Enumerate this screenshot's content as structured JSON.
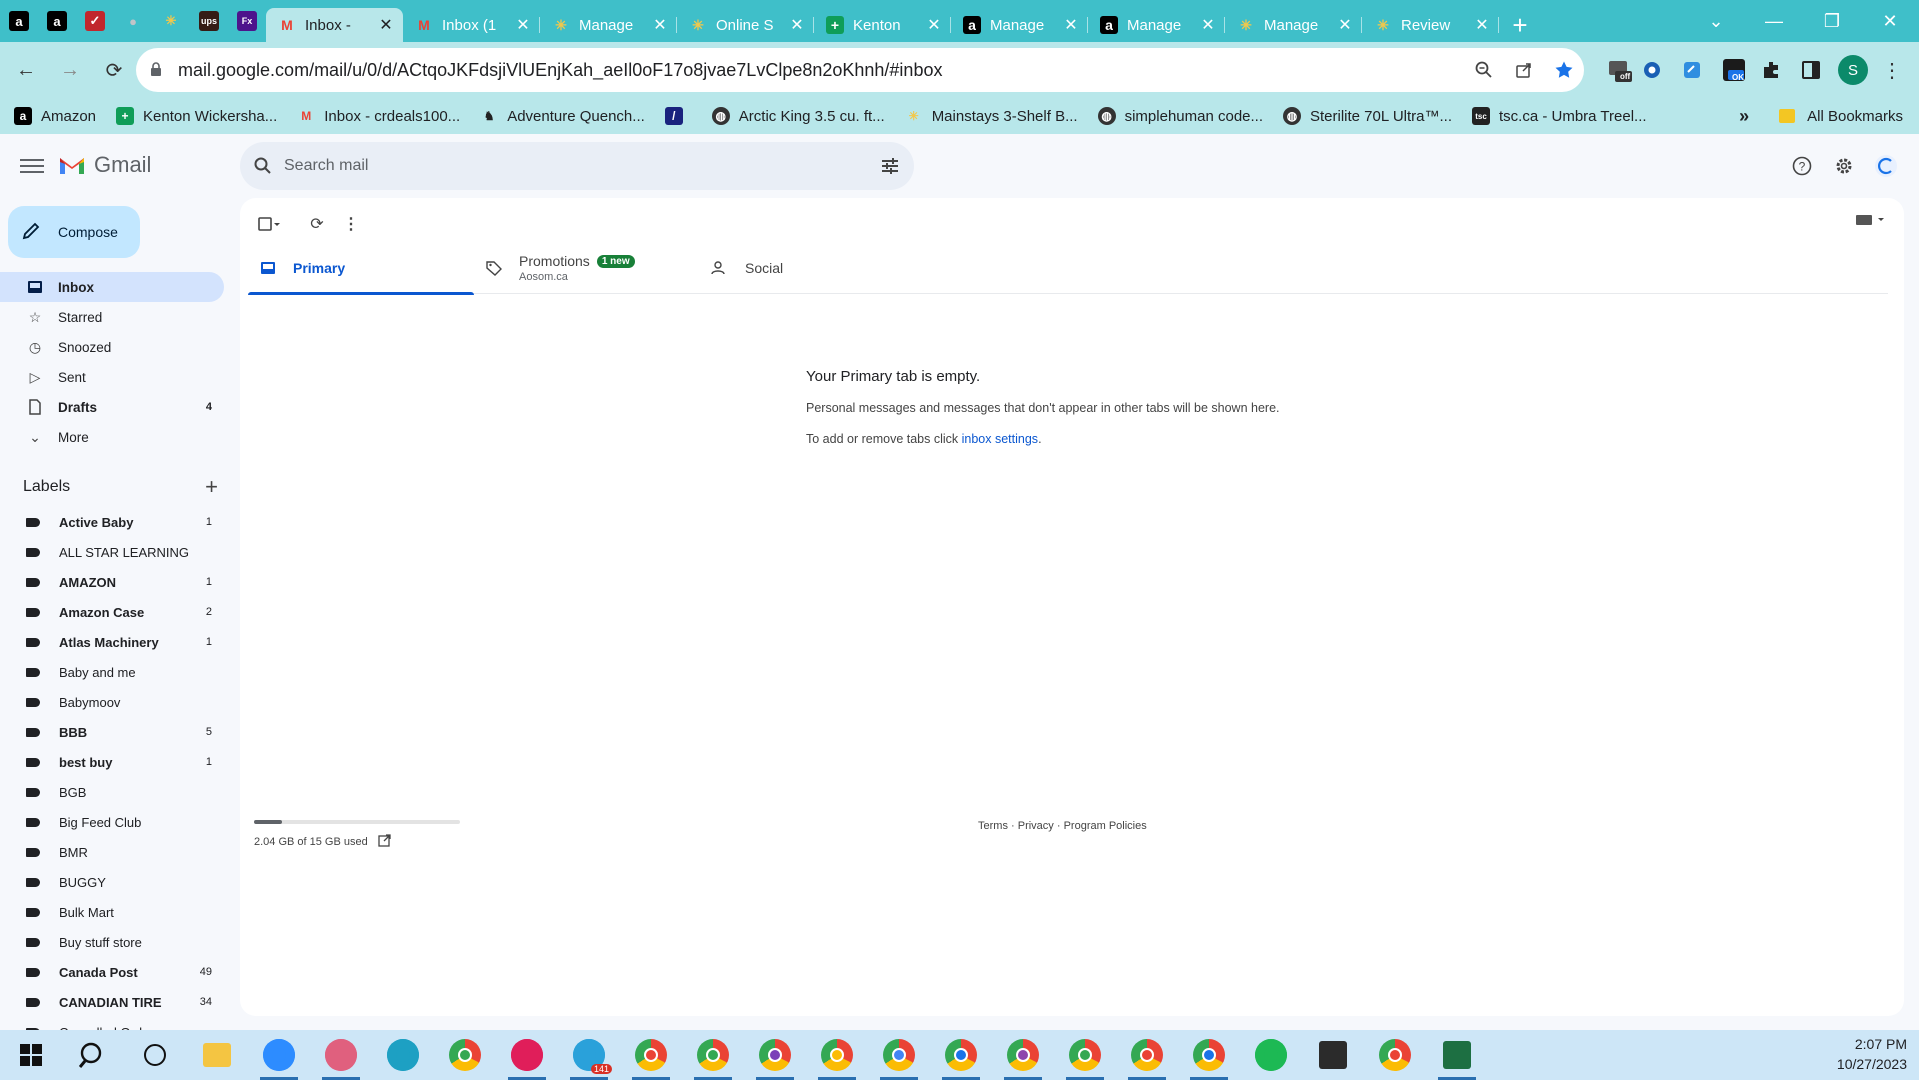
{
  "browser": {
    "pinned_tabs": [
      {
        "icon": "amazon-icon",
        "glyph": "a",
        "color": "#000000"
      },
      {
        "icon": "amazon-icon",
        "glyph": "a",
        "color": "#000000"
      },
      {
        "icon": "brand-checkmark-icon",
        "glyph": "✓",
        "color": "#c1272d"
      },
      {
        "icon": "globe-icon",
        "glyph": "●",
        "color": "#9aa0a6"
      },
      {
        "icon": "walmart-spark-icon",
        "glyph": "✳",
        "color": "#3fbfc9"
      },
      {
        "icon": "ups-icon",
        "glyph": "ups",
        "color": "#351c15"
      },
      {
        "icon": "fedex-icon",
        "glyph": "Fx",
        "color": "#4d148c"
      }
    ],
    "tabs": [
      {
        "title": "Inbox -",
        "icon": "gmail-icon",
        "active": true
      },
      {
        "title": "Inbox (1",
        "icon": "gmail-icon",
        "active": false
      },
      {
        "title": "Manage",
        "icon": "walmart-spark-icon",
        "active": false
      },
      {
        "title": "Online S",
        "icon": "walmart-spark-icon",
        "active": false
      },
      {
        "title": "Kenton",
        "icon": "sheets-icon",
        "active": false
      },
      {
        "title": "Manage",
        "icon": "amazon-icon",
        "active": false
      },
      {
        "title": "Manage",
        "icon": "amazon-icon",
        "active": false
      },
      {
        "title": "Manage",
        "icon": "walmart-spark-icon",
        "active": false
      },
      {
        "title": "Review",
        "icon": "walmart-spark-icon",
        "active": false
      }
    ],
    "url": "mail.google.com/mail/u/0/d/ACtqoJKFdsjiVlUEnjKah_aeIl0oF17o8jvae7LvClpe8n2oKhnh/#inbox",
    "profile_initial": "S",
    "ext_off_badge": "off",
    "ext_ok_badge": "OK",
    "bookmarks": [
      {
        "label": "Amazon",
        "icon": "amazon-icon"
      },
      {
        "label": "Kenton Wickersha...",
        "icon": "sheets-icon"
      },
      {
        "label": "Inbox - crdeals100...",
        "icon": "gmail-icon"
      },
      {
        "label": "Adventure Quench...",
        "icon": "horse-icon"
      },
      {
        "label": "",
        "icon": "dark-app-icon"
      },
      {
        "label": "Arctic King 3.5 cu. ft...",
        "icon": "globe-icon"
      },
      {
        "label": "Mainstays 3-Shelf B...",
        "icon": "walmart-spark-icon"
      },
      {
        "label": "simplehuman code...",
        "icon": "globe-icon"
      },
      {
        "label": "Sterilite 70L Ultra™...",
        "icon": "globe-icon"
      },
      {
        "label": "tsc.ca - Umbra Treel...",
        "icon": "tsc-icon"
      }
    ],
    "bookmarks_more": "»",
    "all_bookmarks": "All Bookmarks"
  },
  "gmail": {
    "app_name": "Gmail",
    "search_placeholder": "Search mail",
    "compose": "Compose",
    "nav": [
      {
        "label": "Inbox",
        "icon": "inbox-icon",
        "count": "",
        "active": true,
        "bold": true
      },
      {
        "label": "Starred",
        "icon": "star-icon",
        "count": "",
        "active": false,
        "bold": false
      },
      {
        "label": "Snoozed",
        "icon": "clock-icon",
        "count": "",
        "active": false,
        "bold": false
      },
      {
        "label": "Sent",
        "icon": "send-icon",
        "count": "",
        "active": false,
        "bold": false
      },
      {
        "label": "Drafts",
        "icon": "draft-icon",
        "count": "4",
        "active": false,
        "bold": true
      },
      {
        "label": "More",
        "icon": "chevron-down-icon",
        "count": "",
        "active": false,
        "bold": false
      }
    ],
    "labels_title": "Labels",
    "labels": [
      {
        "name": "Active Baby",
        "count": "1",
        "bold": true
      },
      {
        "name": "ALL STAR LEARNING",
        "count": "",
        "bold": false
      },
      {
        "name": "AMAZON",
        "count": "1",
        "bold": true
      },
      {
        "name": "Amazon Case",
        "count": "2",
        "bold": true
      },
      {
        "name": "Atlas Machinery",
        "count": "1",
        "bold": true
      },
      {
        "name": "Baby and me",
        "count": "",
        "bold": false
      },
      {
        "name": "Babymoov",
        "count": "",
        "bold": false
      },
      {
        "name": "BBB",
        "count": "5",
        "bold": true
      },
      {
        "name": "best buy",
        "count": "1",
        "bold": true
      },
      {
        "name": "BGB",
        "count": "",
        "bold": false
      },
      {
        "name": "Big Feed Club",
        "count": "",
        "bold": false
      },
      {
        "name": "BMR",
        "count": "",
        "bold": false
      },
      {
        "name": "BUGGY",
        "count": "",
        "bold": false
      },
      {
        "name": "Bulk Mart",
        "count": "",
        "bold": false
      },
      {
        "name": "Buy stuff store",
        "count": "",
        "bold": false
      },
      {
        "name": "Canada Post",
        "count": "49",
        "bold": true
      },
      {
        "name": "CANADIAN TIRE",
        "count": "34",
        "bold": true
      },
      {
        "name": "Cancelled Order",
        "count": "",
        "bold": false
      }
    ],
    "inbox_tabs": [
      {
        "label": "Primary",
        "icon": "inbox-tab-icon",
        "sub": "",
        "badge": "",
        "active": true
      },
      {
        "label": "Promotions",
        "icon": "tag-icon",
        "sub": "Aosom.ca",
        "badge": "1 new",
        "active": false
      },
      {
        "label": "Social",
        "icon": "people-icon",
        "sub": "",
        "badge": "",
        "active": false
      }
    ],
    "empty": {
      "title": "Your Primary tab is empty.",
      "line1": "Personal messages and messages that don't appear in other tabs will be shown here.",
      "line2_prefix": "To add or remove tabs click ",
      "line2_link": "inbox settings",
      "line2_suffix": "."
    },
    "storage": {
      "text": "2.04 GB of 15 GB used",
      "fraction": 0.136
    },
    "footer": {
      "terms": "Terms",
      "privacy": "Privacy",
      "policies": "Program Policies",
      "sep": " · "
    }
  },
  "taskbar": {
    "apps": [
      {
        "icon": "windows-start-icon",
        "color": "#0078d4",
        "running": false
      },
      {
        "icon": "search-icon",
        "color": "#202124",
        "running": false
      },
      {
        "icon": "task-view-icon",
        "color": "#202124",
        "running": false
      },
      {
        "icon": "file-explorer-icon",
        "color": "#f4c542",
        "running": false
      },
      {
        "icon": "zoom-icon",
        "color": "#2d8cff",
        "running": true
      },
      {
        "icon": "snipping-tool-icon",
        "color": "#e0607e",
        "running": true
      },
      {
        "icon": "edge-icon",
        "color": "#1da0c3",
        "running": false
      },
      {
        "icon": "chrome-icon",
        "color": "#34a853",
        "running": false
      },
      {
        "icon": "slack-icon",
        "color": "#e01e5a",
        "running": true
      },
      {
        "icon": "telegram-icon",
        "color": "#2aa1da",
        "running": true
      },
      {
        "icon": "chrome-icon",
        "color": "#ea4335",
        "running": true
      },
      {
        "icon": "chrome-icon",
        "color": "#34a853",
        "running": true
      },
      {
        "icon": "chrome-icon",
        "color": "#7b3fb8",
        "running": true
      },
      {
        "icon": "chrome-icon",
        "color": "#fbbc04",
        "running": true
      },
      {
        "icon": "chrome-icon",
        "color": "#4285f4",
        "running": true
      },
      {
        "icon": "chrome-icon",
        "color": "#1a73e8",
        "running": true
      },
      {
        "icon": "chrome-icon",
        "color": "#8e44ad",
        "running": true
      },
      {
        "icon": "chrome-icon",
        "color": "#34a853",
        "running": true
      },
      {
        "icon": "chrome-icon",
        "color": "#ea4335",
        "running": true
      },
      {
        "icon": "chrome-icon",
        "color": "#1a73e8",
        "running": true
      },
      {
        "icon": "spotify-icon",
        "color": "#1db954",
        "running": false
      },
      {
        "icon": "sticky-notes-icon",
        "color": "#2b2b2b",
        "running": false
      },
      {
        "icon": "chrome-icon",
        "color": "#ea4335",
        "running": false
      },
      {
        "icon": "excel-icon",
        "color": "#1d6f42",
        "running": true
      }
    ],
    "telegram_badge": "141",
    "time": "2:07 PM",
    "date": "10/27/2023"
  }
}
